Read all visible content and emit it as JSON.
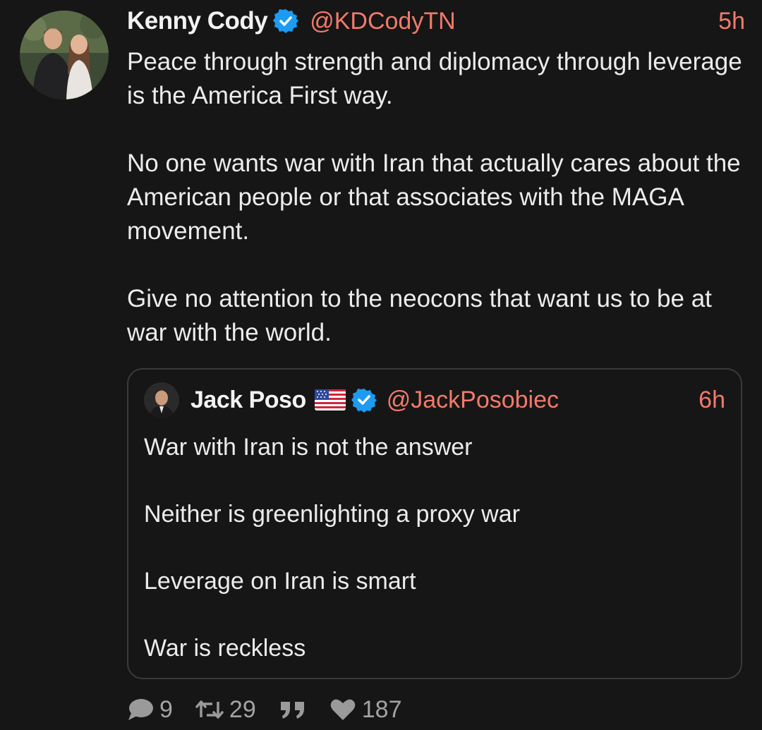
{
  "post": {
    "author": {
      "display_name": "Kenny Cody",
      "handle": "@KDCodyTN",
      "verified": true,
      "avatar": "couple-photo-avatar"
    },
    "time": "5h",
    "paragraphs": [
      "Peace through strength and diplomacy through leverage is the America First way.",
      "No one wants war with Iran that actually cares about the American people or that associates with the MAGA movement.",
      "Give no attention to the neocons that want us to be at war with the world."
    ]
  },
  "quote": {
    "author": {
      "display_name": "Jack Poso",
      "flag": "us-flag-emoji",
      "handle": "@JackPosobiec",
      "verified": true,
      "avatar": "man-portrait-avatar"
    },
    "time": "6h",
    "paragraphs": [
      "War with Iran is not the answer",
      "Neither is greenlighting a proxy war",
      "Leverage on Iran is smart",
      "War is reckless"
    ]
  },
  "actions": {
    "replies": "9",
    "reposts": "29",
    "quote_icon": "quote-icon",
    "likes": "187"
  },
  "colors": {
    "background": "#161616",
    "accent": "#f27a6a",
    "verified": "#1d9bf0",
    "text": "#ececec",
    "muted": "#9a9a9a"
  }
}
